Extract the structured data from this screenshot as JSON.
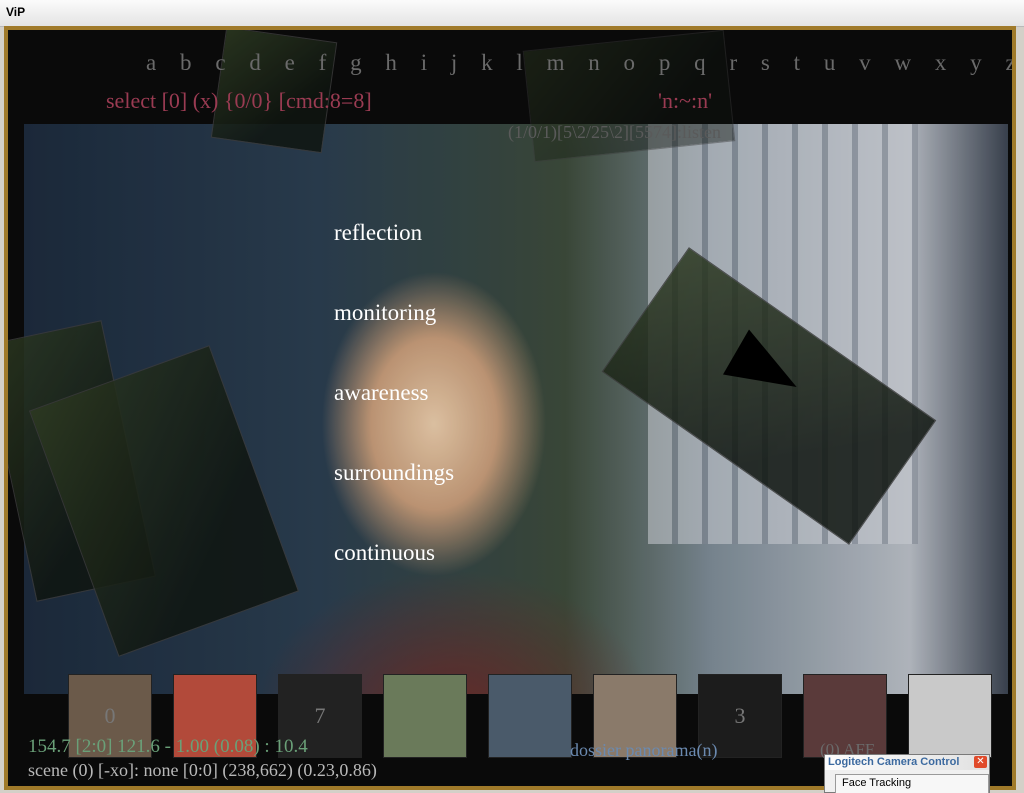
{
  "window": {
    "title": "ViP"
  },
  "alphabet": [
    "a",
    "b",
    "c",
    "d",
    "e",
    "f",
    "g",
    "h",
    "i",
    "j",
    "k",
    "l",
    "m",
    "n",
    "o",
    "p",
    "q",
    "r",
    "s",
    "t",
    "u",
    "v",
    "w",
    "x",
    "y",
    "z"
  ],
  "header": {
    "command": "select [0] (x) {0/0} [cmd:8=8]",
    "n_status": "'n:~:n'",
    "listen": "(1/0/1)[5\\2/25\\2][5574]:listen"
  },
  "menu": {
    "items": [
      "reflection",
      "monitoring",
      "awareness",
      "surroundings",
      "continuous"
    ]
  },
  "thumbnails": [
    {
      "label": "0",
      "kind": "hallway",
      "color": "#6b5a4a"
    },
    {
      "label": "",
      "kind": "portrait",
      "color": "#b24a3a"
    },
    {
      "label": "7",
      "kind": "empty",
      "color": "#222222"
    },
    {
      "label": "",
      "kind": "building",
      "color": "#6a7a5a"
    },
    {
      "label": "",
      "kind": "crowd",
      "color": "#4a5a6a"
    },
    {
      "label": "",
      "kind": "hall",
      "color": "#8a7a6a"
    },
    {
      "label": "3",
      "kind": "empty",
      "color": "#1c1c1c"
    },
    {
      "label": "",
      "kind": "portrait",
      "color": "#5a3a3a"
    },
    {
      "label": "",
      "kind": "face",
      "color": "#c9c9c9"
    }
  ],
  "status": {
    "stats": "154.7 [2:0] 121.6 - 1.00 (0.08) : 10.4",
    "dossier": "dossier panorama(n)",
    "scene": "scene (0) [-xo]: none [0:0] (238,662) (0.23,0.86)",
    "extra": "(0) AFF"
  },
  "logitech": {
    "title": "Logitech Camera Control",
    "tab": "Face Tracking"
  }
}
